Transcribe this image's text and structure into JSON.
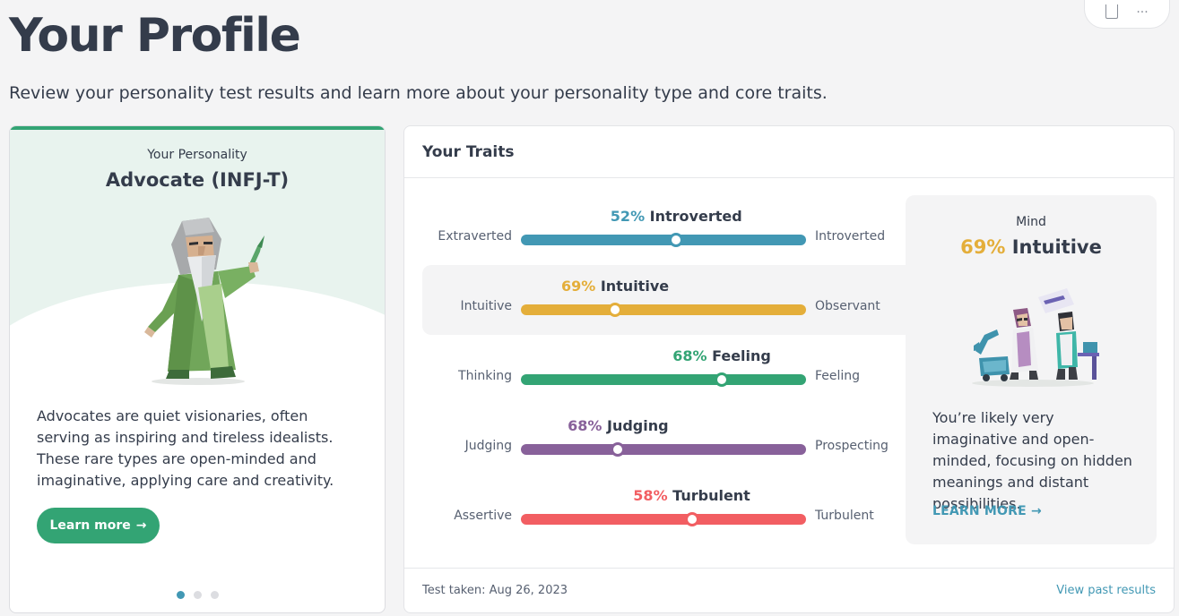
{
  "header": {
    "title": "Your Profile",
    "subtitle": "Review your personality test results and learn more about your personality type and core traits.",
    "share_icon": "share-icon",
    "more_label": "..."
  },
  "personality_card": {
    "label": "Your Personality",
    "type": "Advocate (INFJ-T)",
    "illustration": "advocate-character",
    "description": "Advocates are quiet visionaries, often serving as inspiring and tireless idealists. These rare types are open-minded and imaginative, applying care and creativity.",
    "button_label": "Learn more",
    "button_arrow": "→",
    "carousel_dots": 3,
    "carousel_active_index": 0,
    "accent_color": "#33a474"
  },
  "traits_card": {
    "title": "Your Traits",
    "traits": [
      {
        "percent": "52%",
        "name": "Introverted",
        "left": "Extraverted",
        "right": "Introverted",
        "color": "#4298b4",
        "knob": 0.545,
        "active": false
      },
      {
        "percent": "69%",
        "name": "Intuitive",
        "left": "Intuitive",
        "right": "Observant",
        "color": "#e4ae3a",
        "knob": 0.33,
        "active": true
      },
      {
        "percent": "68%",
        "name": "Feeling",
        "left": "Thinking",
        "right": "Feeling",
        "color": "#33a474",
        "knob": 0.705,
        "active": false
      },
      {
        "percent": "68%",
        "name": "Judging",
        "left": "Judging",
        "right": "Prospecting",
        "color": "#88619a",
        "knob": 0.34,
        "active": false
      },
      {
        "percent": "58%",
        "name": "Turbulent",
        "left": "Assertive",
        "right": "Turbulent",
        "color": "#f25e62",
        "knob": 0.6,
        "active": false
      }
    ],
    "detail": {
      "label": "Mind",
      "percent": "69%",
      "name": "Intuitive",
      "illustration": "intuitive-scientists",
      "description": "You’re likely very imaginative and open-minded, focusing on hidden meanings and distant possibilities.",
      "link_label": "LEARN MORE",
      "link_arrow": "→"
    },
    "footer": {
      "test_taken": "Test taken: Aug 26, 2023",
      "past_results": "View past results"
    }
  }
}
